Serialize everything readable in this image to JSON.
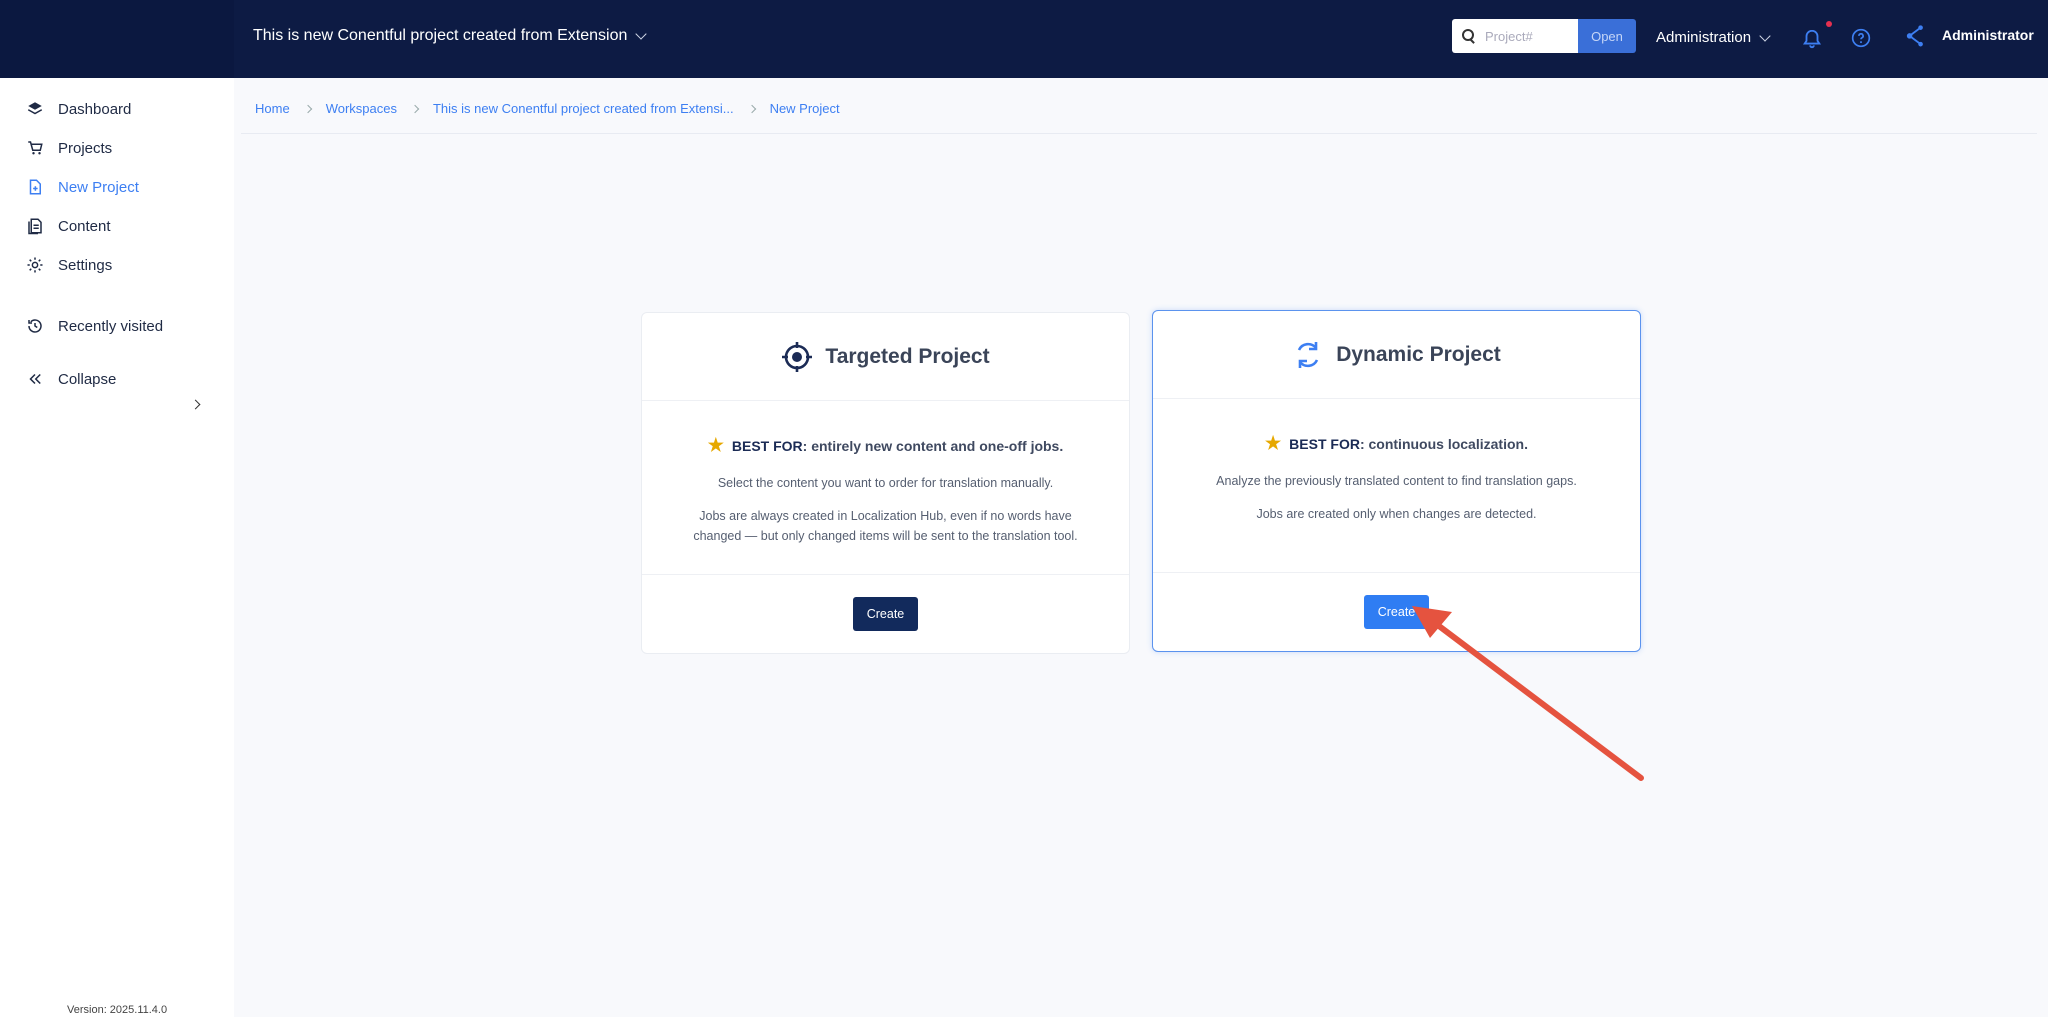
{
  "header": {
    "project_name": "This is new Conentful project created from Extension",
    "search_placeholder": "Project#",
    "open_label": "Open",
    "admin_menu": "Administration",
    "user_name": "Administrator"
  },
  "sidebar": {
    "items": [
      {
        "label": "Dashboard",
        "icon": "layers-icon"
      },
      {
        "label": "Projects",
        "icon": "cart-icon"
      },
      {
        "label": "New Project",
        "icon": "new-file-icon",
        "active": true
      },
      {
        "label": "Content",
        "icon": "document-icon"
      },
      {
        "label": "Settings",
        "icon": "gear-icon"
      }
    ],
    "recently_visited": "Recently visited",
    "collapse": "Collapse",
    "version": "Version: 2025.11.4.0"
  },
  "breadcrumb": [
    "Home",
    "Workspaces",
    "This is new Conentful project created from Extensi...",
    "New Project"
  ],
  "cards": {
    "targeted": {
      "title": "Targeted Project",
      "best_for_label": "BEST FOR",
      "best_for_text": ": entirely new content and one-off jobs.",
      "desc1": "Select the content you want to order for translation manually.",
      "desc2": "Jobs are always created in Localization Hub, even if no words have changed — but only changed items will be sent to the translation tool.",
      "button": "Create"
    },
    "dynamic": {
      "title": "Dynamic Project",
      "best_for_label": "BEST FOR",
      "best_for_text": ": continuous localization.",
      "desc1": "Analyze the previously translated content to find translation gaps.",
      "desc2": "Jobs are created only when changes are detected.",
      "button": "Create"
    }
  },
  "colors": {
    "header_bg": "#0d1b44",
    "accent": "#3d7ff2",
    "dark_button": "#122a5c",
    "annotation_arrow": "#e5533f"
  }
}
